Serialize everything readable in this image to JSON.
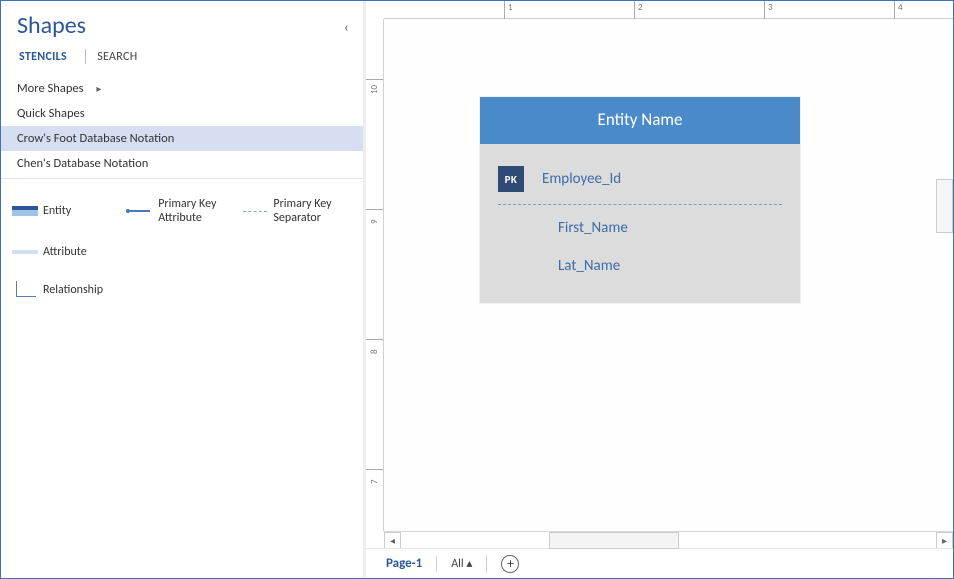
{
  "shapes_panel": {
    "title": "Shapes",
    "tabs": {
      "stencils": "STENCILS",
      "search": "SEARCH"
    },
    "more_shapes": "More Shapes",
    "quick_shapes": "Quick Shapes",
    "stencils": [
      "Crow's Foot Database Notation",
      "Chen's Database Notation"
    ],
    "gallery": {
      "entity": "Entity",
      "pk_attribute": "Primary Key Attribute",
      "pk_separator": "Primary Key Separator",
      "attribute": "Attribute",
      "relationship": "Relationship"
    }
  },
  "canvas": {
    "entity_header": "Entity Name",
    "attributes": {
      "pk_badge": "PK",
      "pk_name": "Employee_Id",
      "first_name": "First_Name",
      "last_name": "Lat_Name"
    },
    "ruler_top_labels": [
      "1",
      "2",
      "3",
      "4"
    ],
    "ruler_left_labels": [
      "10",
      "9",
      "8",
      "7"
    ]
  },
  "footer": {
    "page_label": "Page-1",
    "all_label": "All"
  }
}
